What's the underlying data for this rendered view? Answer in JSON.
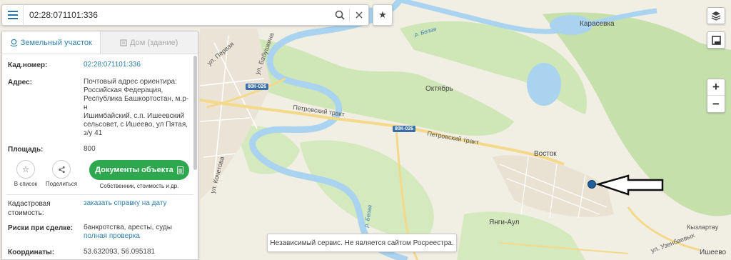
{
  "search": {
    "value": "02:28:071101:336"
  },
  "tabs": [
    {
      "label": "Земельный участок",
      "active": true
    },
    {
      "label": "Дом (здание)",
      "active": false
    }
  ],
  "parcel": {
    "cadastral_label": "Кад.номер:",
    "cadastral_value": "02:28:071101:336",
    "address_label": "Адрес:",
    "address_lines": [
      "Почтовый адрес ориентира:",
      "Российская Федерация,",
      "Республика Башкортостан, м.р-н",
      "Ишимбайский, с.п. Ишеевский",
      "сельсовет, с Ишеево, ул Пятая,",
      "з/у 41"
    ],
    "area_label": "Площадь:",
    "area_value": "800",
    "cost_label_1": "Кадастровая",
    "cost_label_2": "стоимость:",
    "cost_value": "заказать справку на дату",
    "risks_label": "Риски при сделке:",
    "risks_value": "банкротства, аресты, суды",
    "risks_link": "полная проверка",
    "coords_label": "Координаты:",
    "coords_value": "53.632093, 56.095181"
  },
  "actions": {
    "list_label": "В список",
    "share_label": "Поделиться",
    "docs_label": "Документы объекта",
    "docs_sub": "Собственник, стоимость и др."
  },
  "map": {
    "labels": {
      "karasevka": "Карасевка",
      "oktyabr": "Октябрь",
      "vostok": "Восток",
      "yangi_aul": "Янги-Аул",
      "kyzlartau": "Кызлартау",
      "isheevo": "Ишеево",
      "petrovsky_1": "Петровский тракт",
      "petrovsky_2": "Петровский тракт",
      "ul_babushkina": "ул. Бабушкина",
      "ul_kochetova": "ул. Кочетова",
      "ul_pervaya": "ул. Первая",
      "ul_uzenbaeva": "ул. Узенбаевых",
      "r_belaya_1": "р. Белая",
      "r_belaya_2": "р. Белая",
      "shield_1": "80К-026",
      "shield_2": "80К-026"
    },
    "water_color": "#a9d3ef",
    "forest_color": "#c9e2b0",
    "road_color": "#f4d98a",
    "marker_color": "#1f5f9e"
  },
  "notice": "Независимый сервис. Не является сайтом Росреестра."
}
